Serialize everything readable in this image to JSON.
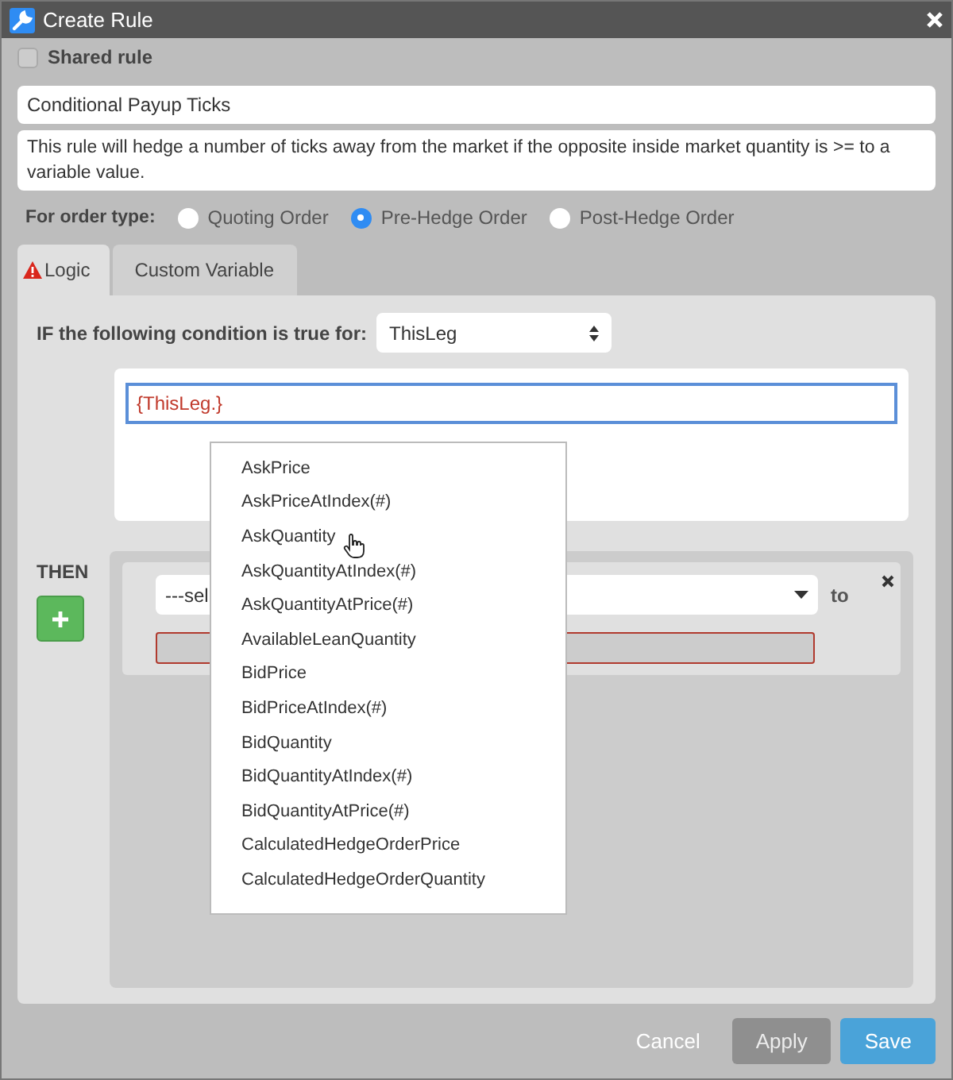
{
  "window": {
    "title": "Create Rule"
  },
  "shared_rule": {
    "label": "Shared rule",
    "checked": false
  },
  "name_field": {
    "value": "Conditional Payup Ticks"
  },
  "description": {
    "value": "This rule will hedge a number of ticks away from the market if the opposite inside market quantity is >= to a variable value."
  },
  "order_type": {
    "label": "For order type:",
    "options": [
      {
        "label": "Quoting Order",
        "selected": false
      },
      {
        "label": "Pre-Hedge Order",
        "selected": true
      },
      {
        "label": "Post-Hedge Order",
        "selected": false
      }
    ]
  },
  "tabs": [
    {
      "label": "Logic",
      "selected": true,
      "warning": true
    },
    {
      "label": "Custom Variable",
      "selected": false,
      "warning": false
    }
  ],
  "condition": {
    "label": "IF the following condition is true for:",
    "target": "ThisLeg",
    "expression": "{ThisLeg.}"
  },
  "then": {
    "label": "THEN",
    "action_select": "---sel",
    "to_label": "to"
  },
  "autocomplete": [
    "AskPrice",
    "AskPriceAtIndex(#)",
    "AskQuantity",
    "AskQuantityAtIndex(#)",
    "AskQuantityAtPrice(#)",
    "AvailableLeanQuantity",
    "BidPrice",
    "BidPriceAtIndex(#)",
    "BidQuantity",
    "BidQuantityAtIndex(#)",
    "BidQuantityAtPrice(#)",
    "CalculatedHedgeOrderPrice",
    "CalculatedHedgeOrderQuantity"
  ],
  "buttons": [
    {
      "label": "Cancel",
      "kind": "link",
      "disabled": false
    },
    {
      "label": "Apply",
      "kind": "secondary",
      "disabled": true
    },
    {
      "label": "Save",
      "kind": "primary",
      "disabled": false
    }
  ]
}
